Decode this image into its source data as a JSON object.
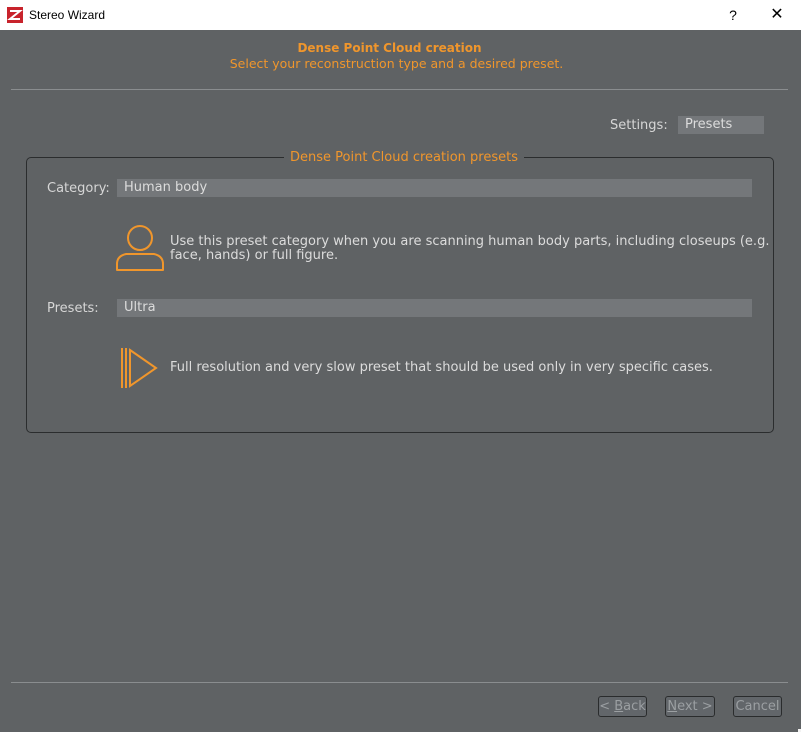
{
  "window": {
    "title": "Stereo Wizard",
    "help_glyph": "?",
    "close_glyph": "✕"
  },
  "header": {
    "title": "Dense Point Cloud creation",
    "subtitle": "Select your reconstruction type and a desired preset."
  },
  "settings": {
    "label": "Settings:",
    "value": "Presets"
  },
  "presets_group": {
    "legend": "Dense Point Cloud creation presets",
    "category_label": "Category:",
    "category_value": "Human body",
    "category_description_line1": "Use this preset category when you are scanning human body parts, including closeups (e.g.",
    "category_description_line2": "face, hands) or full figure.",
    "presets_label": "Presets:",
    "presets_value": "Ultra",
    "preset_description": "Full resolution and very slow preset that should be used only in very specific cases."
  },
  "buttons": {
    "back_prefix": "< ",
    "back_mnemonic": "B",
    "back_rest": "ack",
    "next_mnemonic": "N",
    "next_rest": "ext >",
    "cancel": "Cancel"
  },
  "colors": {
    "accent": "#f0962c",
    "background": "#5f6264",
    "field": "#74777a"
  }
}
